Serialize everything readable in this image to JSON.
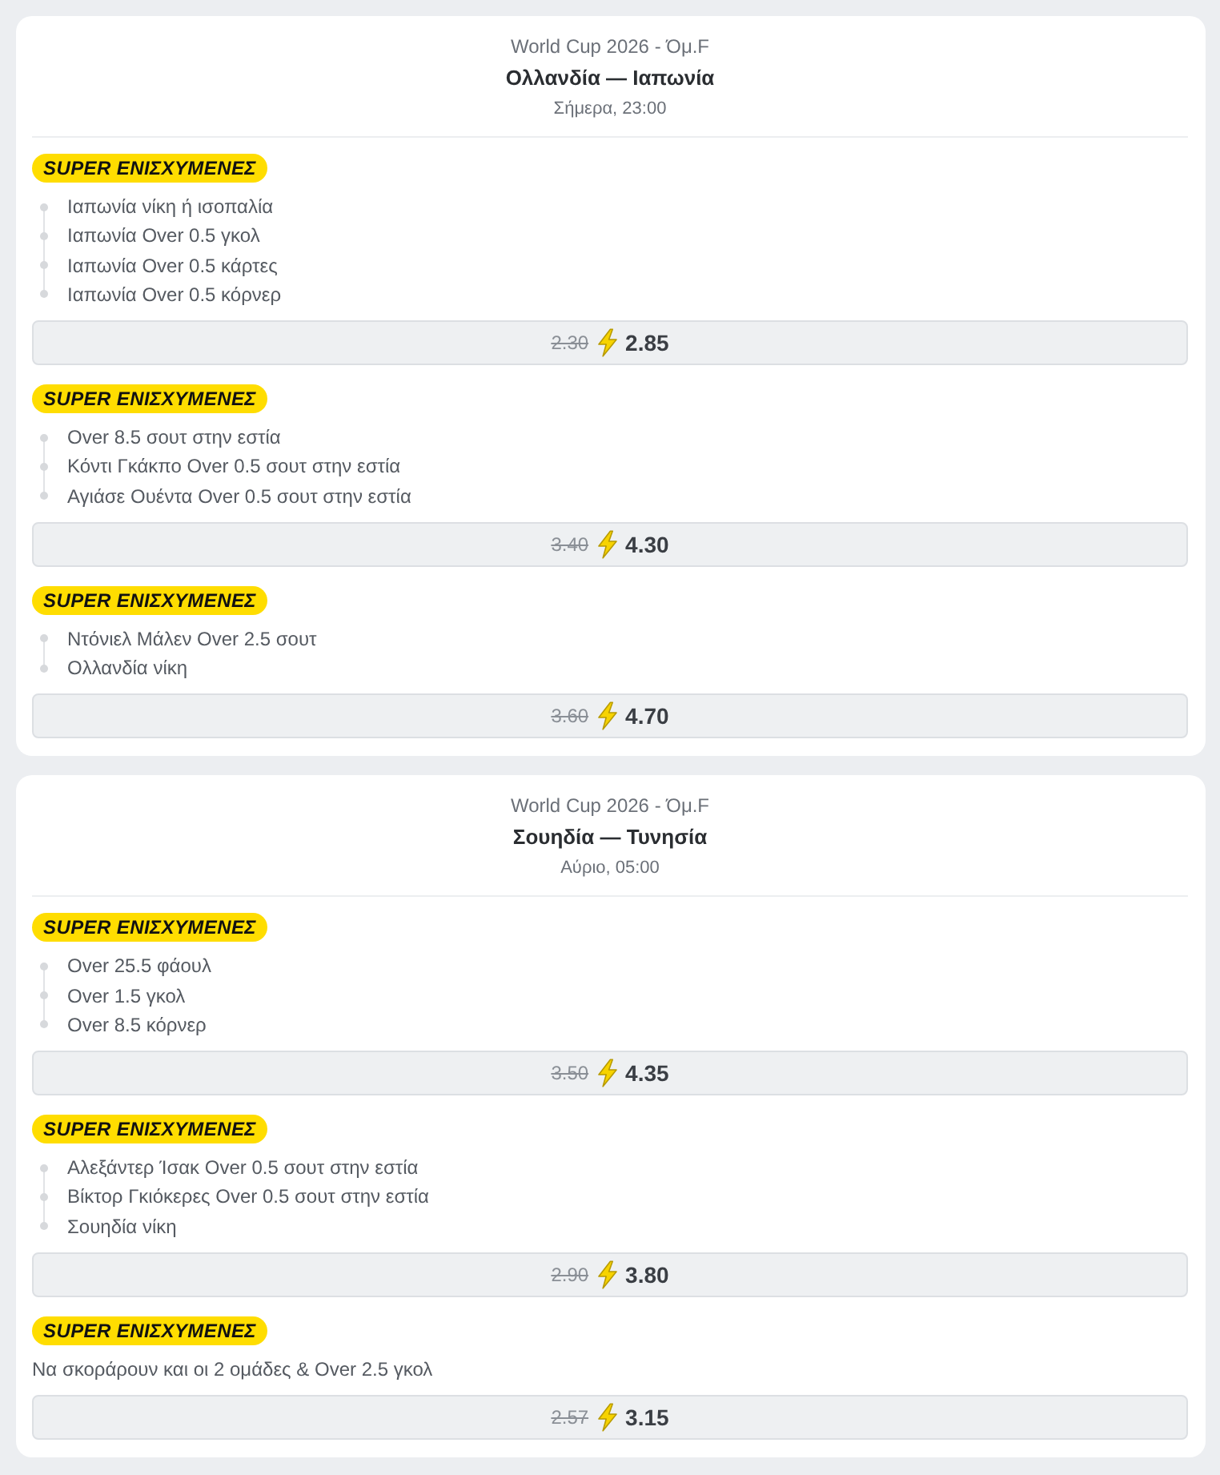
{
  "events": [
    {
      "competition": "World Cup 2026 - Όμ.F",
      "match": "Ολλανδία — Ιαπωνία",
      "time": "Σήμερα, 23:00",
      "offers": [
        {
          "badge": "SUPER ΕΝΙΣΧΥΜΕΝΕΣ",
          "kind": "combo",
          "selections": [
            "Ιαπωνία νίκη ή ισοπαλία",
            "Ιαπωνία Over 0.5 γκολ",
            "Ιαπωνία Over 0.5 κάρτες",
            "Ιαπωνία Over 0.5 κόρνερ"
          ],
          "old_odds": "2.30",
          "new_odds": "2.85"
        },
        {
          "badge": "SUPER ΕΝΙΣΧΥΜΕΝΕΣ",
          "kind": "combo",
          "selections": [
            "Over 8.5 σουτ στην εστία",
            "Κόντι Γκάκπο Over 0.5 σουτ στην εστία",
            "Αγιάσε Ουέντα Over 0.5 σουτ στην εστία"
          ],
          "old_odds": "3.40",
          "new_odds": "4.30"
        },
        {
          "badge": "SUPER ΕΝΙΣΧΥΜΕΝΕΣ",
          "kind": "combo",
          "selections": [
            "Ντόνιελ Μάλεν Over 2.5 σουτ",
            "Ολλανδία νίκη"
          ],
          "old_odds": "3.60",
          "new_odds": "4.70"
        }
      ]
    },
    {
      "competition": "World Cup 2026 - Όμ.F",
      "match": "Σουηδία — Τυνησία",
      "time": "Αύριο, 05:00",
      "offers": [
        {
          "badge": "SUPER ΕΝΙΣΧΥΜΕΝΕΣ",
          "kind": "combo",
          "selections": [
            "Over 25.5 φάουλ",
            "Over 1.5 γκολ",
            "Over 8.5 κόρνερ"
          ],
          "old_odds": "3.50",
          "new_odds": "4.35"
        },
        {
          "badge": "SUPER ΕΝΙΣΧΥΜΕΝΕΣ",
          "kind": "combo",
          "selections": [
            "Αλεξάντερ Ίσακ Over 0.5 σουτ στην εστία",
            "Βίκτορ Γκιόκερες Over 0.5 σουτ στην εστία",
            "Σουηδία νίκη"
          ],
          "old_odds": "2.90",
          "new_odds": "3.80"
        },
        {
          "badge": "SUPER ΕΝΙΣΧΥΜΕΝΕΣ",
          "kind": "single",
          "selections": [
            "Να σκοράρουν και οι 2 ομάδες & Over 2.5 γκολ"
          ],
          "old_odds": "2.57",
          "new_odds": "3.15"
        }
      ]
    }
  ]
}
